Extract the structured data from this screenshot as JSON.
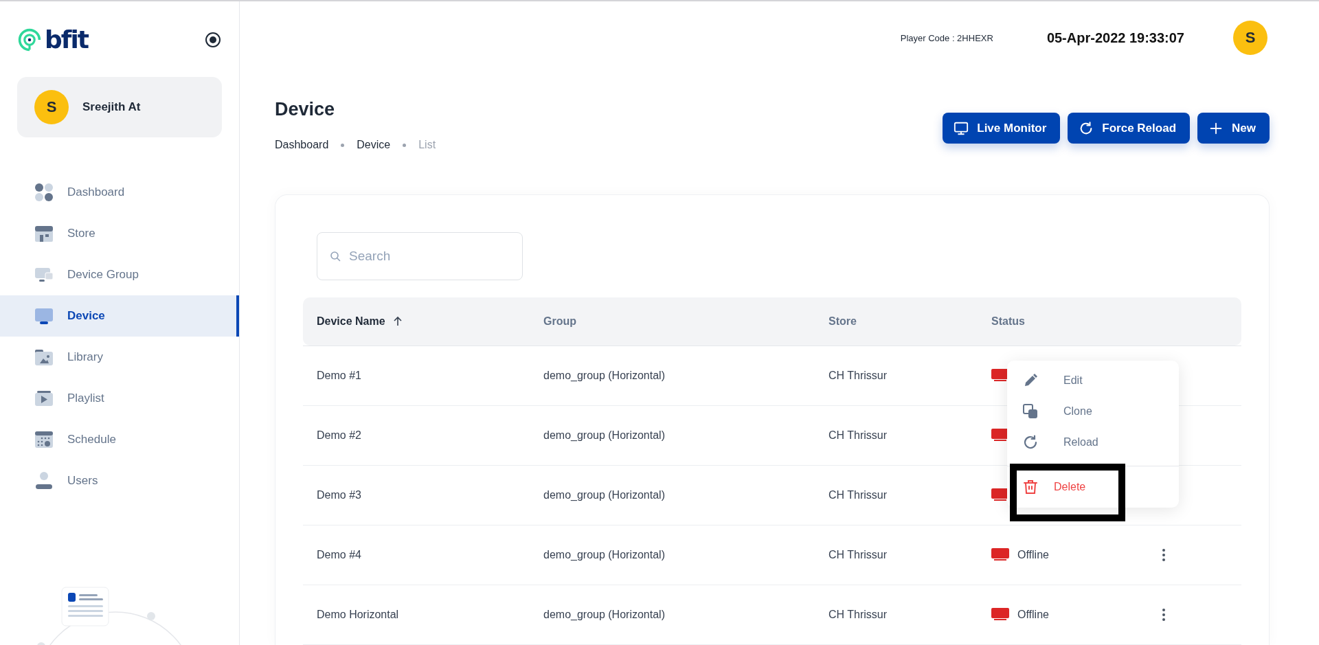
{
  "logo": {
    "text": "bfit"
  },
  "user": {
    "initial": "S",
    "name": "Sreejith At"
  },
  "nav": [
    {
      "label": "Dashboard",
      "kind": "dashboard",
      "selected": false
    },
    {
      "label": "Store",
      "kind": "store",
      "selected": false
    },
    {
      "label": "Device Group",
      "kind": "devicegroup",
      "selected": false
    },
    {
      "label": "Device",
      "kind": "device",
      "selected": true
    },
    {
      "label": "Library",
      "kind": "library",
      "selected": false
    },
    {
      "label": "Playlist",
      "kind": "playlist",
      "selected": false
    },
    {
      "label": "Schedule",
      "kind": "schedule",
      "selected": false
    },
    {
      "label": "Users",
      "kind": "users",
      "selected": false
    }
  ],
  "topbar": {
    "player_code": "Player Code : 2HHEXR",
    "datetime": "05-Apr-2022 19:33:07",
    "avatar_initial": "S"
  },
  "page": {
    "title": "Device",
    "breadcrumb": [
      {
        "label": "Dashboard",
        "current": false
      },
      {
        "label": "Device",
        "current": false
      },
      {
        "label": "List",
        "current": true
      }
    ]
  },
  "actions": [
    {
      "label": "Live Monitor",
      "kind": "monitor"
    },
    {
      "label": "Force Reload",
      "kind": "reload"
    },
    {
      "label": "New",
      "kind": "plus"
    }
  ],
  "search": {
    "placeholder": "Search"
  },
  "table": {
    "columns": [
      {
        "label": "Device Name",
        "sorted": true
      },
      {
        "label": "Group",
        "sorted": false
      },
      {
        "label": "Store",
        "sorted": false
      },
      {
        "label": "Status",
        "sorted": false
      }
    ],
    "rows": [
      {
        "name": "Demo #1",
        "group": "demo_group (Horizontal)",
        "store": "CH Thrissur",
        "online": false,
        "menu_visible": false
      },
      {
        "name": "Demo #2",
        "group": "demo_group (Horizontal)",
        "store": "CH Thrissur",
        "online": false,
        "menu_visible": false
      },
      {
        "name": "Demo #3",
        "group": "demo_group (Horizontal)",
        "store": "CH Thrissur",
        "online": false,
        "menu_visible": false
      },
      {
        "name": "Demo #4",
        "group": "demo_group (Horizontal)",
        "store": "CH Thrissur",
        "online": false,
        "status": "Offline",
        "menu_visible": true
      },
      {
        "name": "Demo Horizontal",
        "group": "demo_group (Horizontal)",
        "store": "CH Thrissur",
        "online": false,
        "status": "Offline",
        "menu_visible": true
      }
    ]
  },
  "context_menu": {
    "items": [
      {
        "label": "Edit",
        "kind": "edit"
      },
      {
        "label": "Clone",
        "kind": "clone"
      },
      {
        "label": "Reload",
        "kind": "reload"
      },
      {
        "label": "Delete",
        "kind": "delete",
        "highlighted": true
      }
    ]
  }
}
